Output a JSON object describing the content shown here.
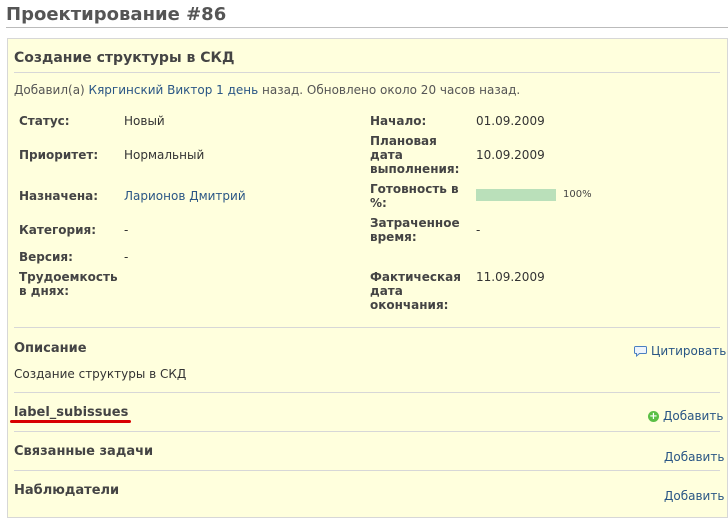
{
  "page": {
    "title": "Проектирование #86"
  },
  "issue": {
    "subject": "Создание структуры в СКД",
    "author": {
      "prefix": "Добавил(а) ",
      "name": "Кяргинский Виктор",
      "age": "1 день",
      "suffix": " назад. Обновлено около 20 часов назад."
    },
    "attributes": {
      "status": {
        "label": "Статус:",
        "value": "Новый"
      },
      "priority": {
        "label": "Приоритет:",
        "value": "Нормальный"
      },
      "assigned": {
        "label": "Назначена:",
        "value": "Ларионов Дмитрий"
      },
      "category": {
        "label": "Категория:",
        "value": "-"
      },
      "version": {
        "label": "Версия:",
        "value": "-"
      },
      "labor": {
        "label": "Трудоемкость в днях:",
        "value": ""
      },
      "start_date": {
        "label": "Начало:",
        "value": "01.09.2009"
      },
      "due_date": {
        "label": "Плановая дата выполнения:",
        "value": "10.09.2009"
      },
      "done_ratio": {
        "label": "Готовность в %:",
        "value": "100%",
        "fraction": 1.0
      },
      "spent_time": {
        "label": "Затраченное время:",
        "value": "-"
      },
      "actual_end": {
        "label": "Фактическая дата окончания:",
        "value": "11.09.2009"
      }
    }
  },
  "description": {
    "title": "Описание",
    "text": "Создание структуры в СКД",
    "quote_label": "Цитировать",
    "quote_icon": "speech-bubble-icon"
  },
  "subissues": {
    "title": "label_subissues",
    "add_label": "Добавить",
    "add_icon": "green-plus-circle-icon"
  },
  "relations": {
    "title": "Связанные задачи",
    "add_label": "Добавить"
  },
  "watchers": {
    "title": "Наблюдатели",
    "add_label": "Добавить"
  },
  "colors": {
    "accent_link": "#2a5685",
    "box_bg": "#ffffdd",
    "progress": "#bae0ba",
    "highlight": "#d80000"
  }
}
